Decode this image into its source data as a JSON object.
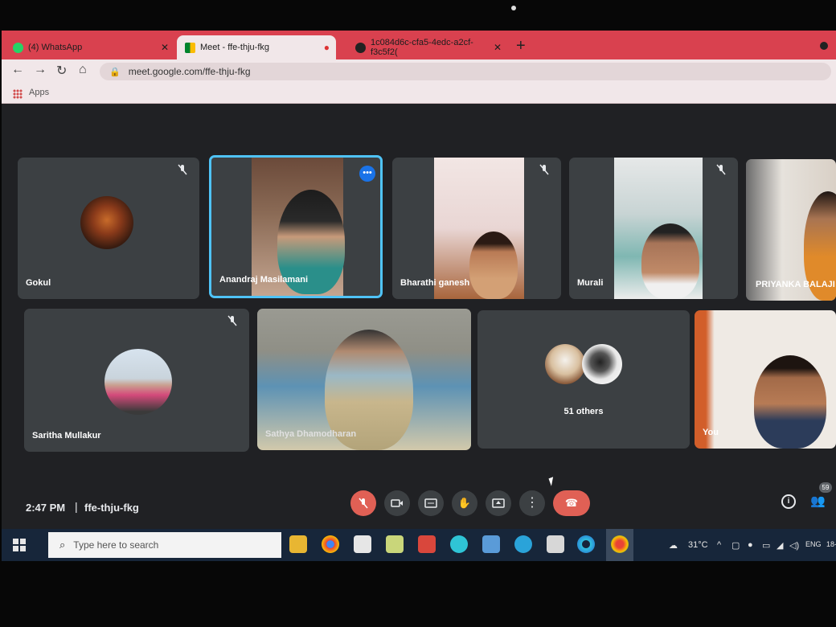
{
  "browser": {
    "tabs": [
      {
        "title": "(4) WhatsApp",
        "icon": "whatsapp-icon",
        "active": false
      },
      {
        "title": "Meet - ffe-thju-fkg",
        "icon": "google-meet-icon",
        "active": true
      },
      {
        "title": "1c084d6c-cfa5-4edc-a2cf-f3c5f2(",
        "icon": "globe-icon",
        "active": false
      }
    ],
    "close_glyph": "✕",
    "new_tab_glyph": "+",
    "url": "meet.google.com/ffe-thju-fkg",
    "bookmarks_apps_label": "Apps"
  },
  "meet": {
    "participants_row1": [
      {
        "name": "Gokul",
        "muted": true
      },
      {
        "name": "Anandraj Masilamani",
        "muted": false,
        "speaking": true
      },
      {
        "name": "Bharathi ganesh",
        "muted": true
      },
      {
        "name": "Murali",
        "muted": true
      },
      {
        "name": "PRIYANKA BALAJI",
        "muted": false
      }
    ],
    "participants_row2": [
      {
        "name": "Saritha Mullakur",
        "muted": true
      },
      {
        "name": "Sathya Dhamodharan",
        "muted": false
      },
      {
        "name": "51 others",
        "muted": false
      },
      {
        "name": "You",
        "muted": false
      }
    ],
    "time": "2:47 PM",
    "separator": "|",
    "meeting_code": "ffe-thju-fkg",
    "people_count": "59",
    "controls": [
      "mic-off-button",
      "camera-button",
      "captions-button",
      "raise-hand-button",
      "present-button",
      "more-options-button",
      "end-call-button"
    ]
  },
  "taskbar": {
    "search_placeholder": "Type here to search",
    "weather": "31°C",
    "language": "ENG",
    "date_fragment": "18-"
  },
  "colors": {
    "tab_bar": "#d9414f",
    "meet_bg": "#202124",
    "tile_bg": "#3c4043",
    "speaking_border": "#4fc3f7",
    "end_call": "#e06055",
    "taskbar": "#17263a"
  }
}
